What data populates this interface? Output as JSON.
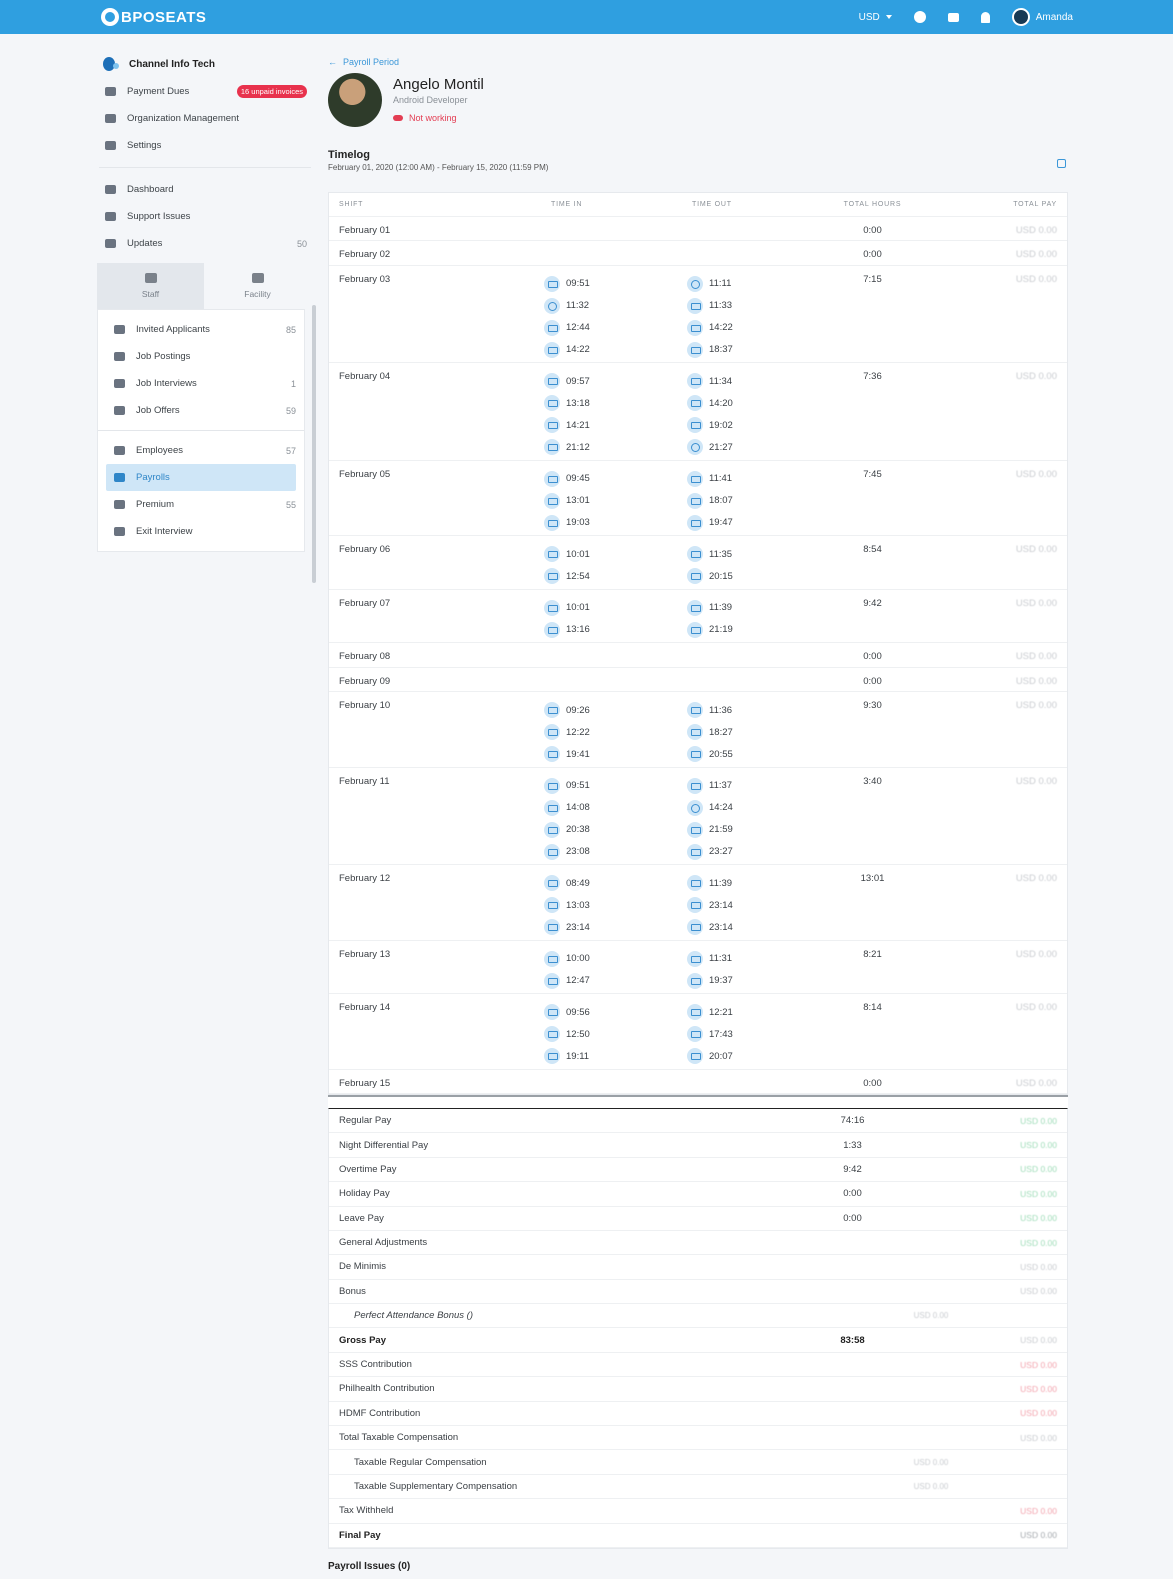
{
  "topbar": {
    "brand": "BPOSEATS",
    "currency": "USD",
    "user": "Amanda",
    "icons": [
      "facebook-icon",
      "chat-icon",
      "bell-icon"
    ]
  },
  "sidebar": {
    "org_name": "Channel Info Tech",
    "items": [
      {
        "label": "Payment Dues",
        "badge": "16 unpaid invoices",
        "icon": "book-icon"
      },
      {
        "label": "Organization Management",
        "icon": "people-icon"
      },
      {
        "label": "Settings",
        "icon": "gear-icon"
      }
    ],
    "items2": [
      {
        "label": "Dashboard",
        "icon": "dashboard-icon"
      },
      {
        "label": "Support Issues",
        "icon": "message-icon"
      },
      {
        "label": "Updates",
        "count": "50",
        "icon": "megaphone-icon"
      }
    ],
    "tabs": [
      {
        "label": "Staff",
        "icon": "group-icon"
      },
      {
        "label": "Facility",
        "icon": "building-icon"
      }
    ],
    "staff_items": [
      {
        "label": "Invited Applicants",
        "count": "85"
      },
      {
        "label": "Job Postings",
        "count": ""
      },
      {
        "label": "Job Interviews",
        "count": "1"
      },
      {
        "label": "Job Offers",
        "count": "59"
      }
    ],
    "staff_items2": [
      {
        "label": "Employees",
        "count": "57"
      },
      {
        "label": "Payrolls",
        "count": ""
      },
      {
        "label": "Premium",
        "count": "55"
      },
      {
        "label": "Exit Interview",
        "count": ""
      }
    ]
  },
  "main": {
    "back_label": "Payroll Period",
    "employee": {
      "name": "Angelo Montil",
      "role": "Android Developer",
      "status": "Not working"
    },
    "timelog_title": "Timelog",
    "timelog_range": "February 01, 2020 (12:00 AM) - February 15, 2020 (11:59 PM)",
    "columns": [
      "SHIFT",
      "TIME IN",
      "TIME OUT",
      "TOTAL HOURS",
      "TOTAL PAY"
    ],
    "rows": [
      {
        "date": "February 01",
        "in": [],
        "out": [],
        "total": "0:00",
        "pay": "USD 0.00"
      },
      {
        "date": "February 02",
        "in": [],
        "out": [],
        "total": "0:00",
        "pay": "USD 0.00"
      },
      {
        "date": "February 03",
        "in": [
          [
            "09:51",
            "d"
          ],
          [
            "11:32",
            "w"
          ],
          [
            "12:44",
            "d"
          ],
          [
            "14:22",
            "d"
          ]
        ],
        "out": [
          [
            "11:11",
            "w"
          ],
          [
            "11:33",
            "d"
          ],
          [
            "14:22",
            "d"
          ],
          [
            "18:37",
            "d"
          ]
        ],
        "total": "7:15",
        "pay": "USD 0.00"
      },
      {
        "date": "February 04",
        "in": [
          [
            "09:57",
            "d"
          ],
          [
            "13:18",
            "d"
          ],
          [
            "14:21",
            "d"
          ],
          [
            "21:12",
            "d"
          ]
        ],
        "out": [
          [
            "11:34",
            "d"
          ],
          [
            "14:20",
            "d"
          ],
          [
            "19:02",
            "d"
          ],
          [
            "21:27",
            "w"
          ]
        ],
        "total": "7:36",
        "pay": "USD 0.00"
      },
      {
        "date": "February 05",
        "in": [
          [
            "09:45",
            "d"
          ],
          [
            "13:01",
            "d"
          ],
          [
            "19:03",
            "d"
          ]
        ],
        "out": [
          [
            "11:41",
            "d"
          ],
          [
            "18:07",
            "d"
          ],
          [
            "19:47",
            "d"
          ]
        ],
        "total": "7:45",
        "pay": "USD 0.00"
      },
      {
        "date": "February 06",
        "in": [
          [
            "10:01",
            "d"
          ],
          [
            "12:54",
            "d"
          ]
        ],
        "out": [
          [
            "11:35",
            "d"
          ],
          [
            "20:15",
            "d"
          ]
        ],
        "total": "8:54",
        "pay": "USD 0.00"
      },
      {
        "date": "February 07",
        "in": [
          [
            "10:01",
            "d"
          ],
          [
            "13:16",
            "d"
          ]
        ],
        "out": [
          [
            "11:39",
            "d"
          ],
          [
            "21:19",
            "d"
          ]
        ],
        "total": "9:42",
        "pay": "USD 0.00"
      },
      {
        "date": "February 08",
        "in": [],
        "out": [],
        "total": "0:00",
        "pay": "USD 0.00"
      },
      {
        "date": "February 09",
        "in": [],
        "out": [],
        "total": "0:00",
        "pay": "USD 0.00"
      },
      {
        "date": "February 10",
        "in": [
          [
            "09:26",
            "d"
          ],
          [
            "12:22",
            "d"
          ],
          [
            "19:41",
            "d"
          ]
        ],
        "out": [
          [
            "11:36",
            "d"
          ],
          [
            "18:27",
            "d"
          ],
          [
            "20:55",
            "d"
          ]
        ],
        "total": "9:30",
        "pay": "USD 0.00"
      },
      {
        "date": "February 11",
        "in": [
          [
            "09:51",
            "d"
          ],
          [
            "14:08",
            "d"
          ],
          [
            "20:38",
            "d"
          ],
          [
            "23:08",
            "d"
          ]
        ],
        "out": [
          [
            "11:37",
            "d"
          ],
          [
            "14:24",
            "w"
          ],
          [
            "21:59",
            "d"
          ],
          [
            "23:27",
            "d"
          ]
        ],
        "total": "3:40",
        "pay": "USD 0.00"
      },
      {
        "date": "February 12",
        "in": [
          [
            "08:49",
            "d"
          ],
          [
            "13:03",
            "d"
          ],
          [
            "23:14",
            "d"
          ]
        ],
        "out": [
          [
            "11:39",
            "d"
          ],
          [
            "23:14",
            "d"
          ],
          [
            "23:14",
            "d"
          ]
        ],
        "total": "13:01",
        "pay": "USD 0.00"
      },
      {
        "date": "February 13",
        "in": [
          [
            "10:00",
            "d"
          ],
          [
            "12:47",
            "d"
          ]
        ],
        "out": [
          [
            "11:31",
            "d"
          ],
          [
            "19:37",
            "d"
          ]
        ],
        "total": "8:21",
        "pay": "USD 0.00"
      },
      {
        "date": "February 14",
        "in": [
          [
            "09:56",
            "d"
          ],
          [
            "12:50",
            "d"
          ],
          [
            "19:11",
            "d"
          ]
        ],
        "out": [
          [
            "12:21",
            "d"
          ],
          [
            "17:43",
            "d"
          ],
          [
            "20:07",
            "d"
          ]
        ],
        "total": "8:14",
        "pay": "USD 0.00"
      },
      {
        "date": "February 15",
        "in": [],
        "out": [],
        "total": "0:00",
        "pay": "USD 0.00"
      }
    ],
    "summary": [
      {
        "label": "Regular Pay",
        "hours": "74:16",
        "pay": "USD 0.00",
        "tone": "green"
      },
      {
        "label": "Night Differential Pay",
        "hours": "1:33",
        "pay": "USD 0.00",
        "tone": "green"
      },
      {
        "label": "Overtime Pay",
        "hours": "9:42",
        "pay": "USD 0.00",
        "tone": "green"
      },
      {
        "label": "Holiday Pay",
        "hours": "0:00",
        "pay": "USD 0.00",
        "tone": "green"
      },
      {
        "label": "Leave Pay",
        "hours": "0:00",
        "pay": "USD 0.00",
        "tone": "green"
      },
      {
        "label": "General Adjustments",
        "hours": "",
        "pay": "USD 0.00",
        "tone": "green"
      },
      {
        "label": "De Minimis",
        "hours": "",
        "pay": "USD 0.00",
        "tone": "grey"
      },
      {
        "label": "Bonus",
        "hours": "",
        "pay": "USD 0.00",
        "tone": "grey"
      },
      {
        "label": "Perfect Attendance Bonus ()",
        "hours": "",
        "mid": "USD 0.00",
        "pay": "",
        "tone": "grey",
        "sub": true,
        "italic": true
      },
      {
        "label": "Gross Pay",
        "hours": "83:58",
        "pay": "USD 0.00",
        "tone": "grey",
        "bold": true
      },
      {
        "label": "SSS Contribution",
        "hours": "",
        "pay": "USD 0.00",
        "tone": "red"
      },
      {
        "label": "Philhealth Contribution",
        "hours": "",
        "pay": "USD 0.00",
        "tone": "red"
      },
      {
        "label": "HDMF Contribution",
        "hours": "",
        "pay": "USD 0.00",
        "tone": "red"
      },
      {
        "label": "Total Taxable Compensation",
        "hours": "",
        "pay": "USD 0.00",
        "tone": "grey"
      },
      {
        "label": "Taxable Regular Compensation",
        "hours": "",
        "mid": "USD 0.00",
        "pay": "",
        "tone": "grey",
        "sub": true
      },
      {
        "label": "Taxable Supplementary Compensation",
        "hours": "",
        "mid": "USD 0.00",
        "pay": "",
        "tone": "grey",
        "sub": true
      },
      {
        "label": "Tax Withheld",
        "hours": "",
        "pay": "USD 0.00",
        "tone": "red"
      },
      {
        "label": "Final Pay",
        "hours": "",
        "pay": "USD 0.00",
        "tone": "dark",
        "bold": true
      }
    ],
    "issues_label": "Payroll Issues (0)"
  }
}
